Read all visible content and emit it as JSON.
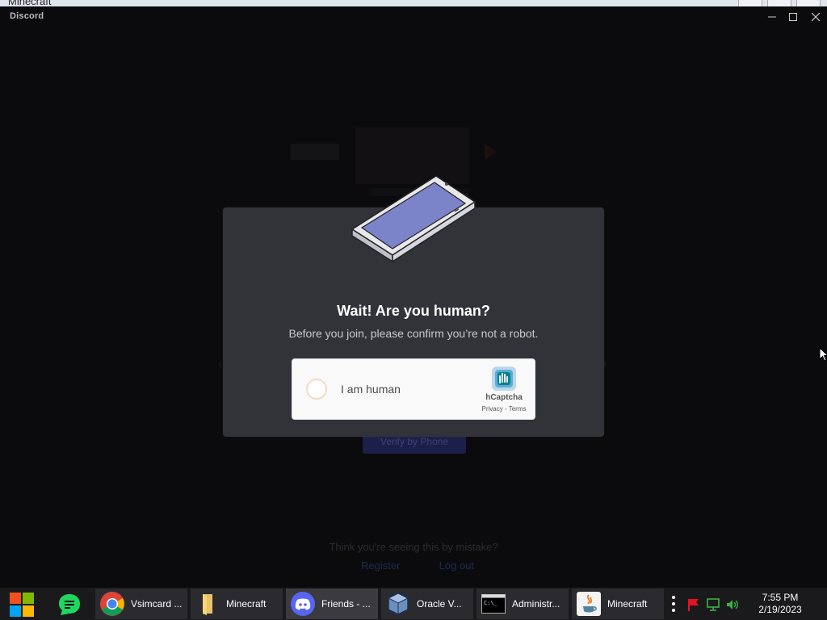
{
  "outer_window": {
    "title": "Minecraft"
  },
  "app": {
    "name": "Discord"
  },
  "background": {
    "verify_button": "Verify by Phone",
    "mistake_text": "Think you're seeing this by mistake?",
    "links": [
      "Register",
      "Log out"
    ]
  },
  "modal": {
    "title": "Wait! Are you human?",
    "subtitle": "Before you join, please confirm you’re not a robot.",
    "captcha": {
      "checkbox_label": "I am human",
      "brand": "hCaptcha",
      "privacy": "Privacy",
      "separator": " - ",
      "terms": "Terms"
    }
  },
  "taskbar": {
    "tasks": [
      {
        "label": "Vsimcard ...",
        "icon": "chrome-icon"
      },
      {
        "label": "Minecraft",
        "icon": "folder-icon"
      },
      {
        "label": "Friends - ...",
        "icon": "discord-icon"
      },
      {
        "label": "Oracle V...",
        "icon": "virtualbox-icon"
      },
      {
        "label": "Administr...",
        "icon": "cmd-icon"
      },
      {
        "label": "Minecraft",
        "icon": "java-icon"
      }
    ],
    "clock": {
      "time": "7:55 PM",
      "date": "2/19/2023"
    }
  },
  "colors": {
    "modal_bg": "#323339",
    "window_bg": "#0b0b0d",
    "taskbar_bg": "#1a1a1d",
    "hcaptcha_teal": "#0074bf"
  }
}
